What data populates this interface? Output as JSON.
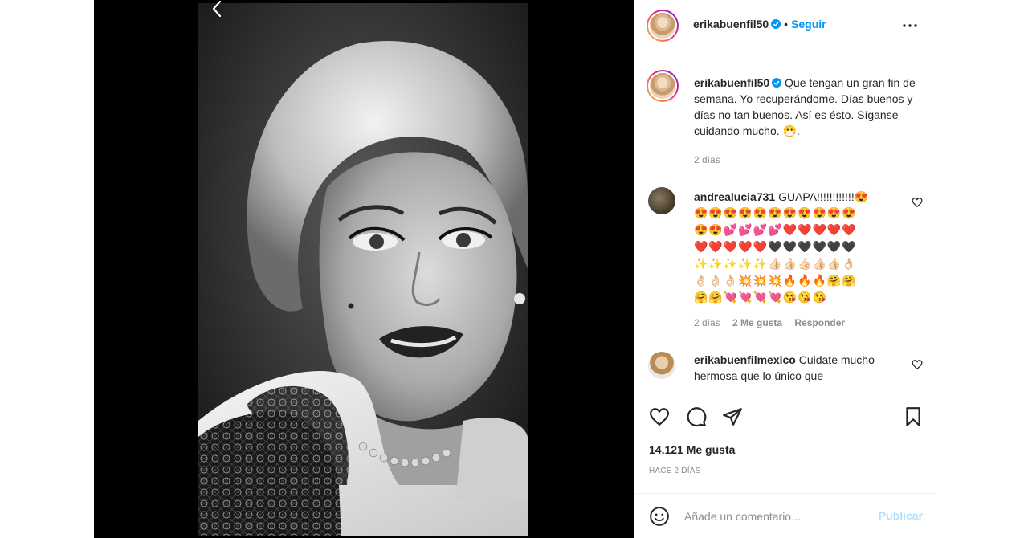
{
  "post_author": {
    "username": "erikabuenfil50",
    "follow_label": "Seguir",
    "separator": "•"
  },
  "caption": {
    "username": "erikabuenfil50",
    "text": "Que tengan un gran fin de semana. Yo recuperándome. Días buenos y días no tan buenos. Así es ésto. Síganse cuidando mucho. 😷.",
    "time": "2 días"
  },
  "comments": [
    {
      "username": "andrealucia731",
      "text": "GUAPA!!!!!!!!!!!!😍",
      "emoji_lines": [
        "😍😍😍😍😍😍😍😍😍😍😍",
        "😍😍💕💕💕💕❤️❤️❤️❤️❤️",
        "❤️❤️❤️❤️❤️🖤🖤🖤🖤🖤🖤",
        "✨✨✨✨✨👍🏻👍🏻👍🏻👍🏻👍🏻👌🏻",
        "👌🏻👌🏻👌🏻💥💥💥🔥🔥🔥🤗🤗",
        "🤗🤗💘💘💘💘😘😘😘"
      ],
      "time": "2 días",
      "likes": "2 Me gusta",
      "reply": "Responder"
    },
    {
      "username": "erikabuenfilmexico",
      "text": "Cuidate mucho hermosa que lo único que"
    }
  ],
  "actions": {
    "likes": "14.121 Me gusta",
    "time": "Hace 2 días"
  },
  "add_comment": {
    "placeholder": "Añade un comentario...",
    "publish_label": "Publicar"
  },
  "icons": {
    "back": "chevron-left-icon",
    "more": "more-options-icon",
    "verified": "verified-badge-icon",
    "like": "heart-icon",
    "comment": "comment-bubble-icon",
    "share": "paper-plane-icon",
    "save": "bookmark-icon",
    "emoji": "smiley-icon"
  },
  "colors": {
    "accent": "#0095f6",
    "publish_disabled": "#b2dffc",
    "text": "#262626",
    "muted": "#8e8e8e",
    "border": "#efefef",
    "media_bg": "#000000"
  }
}
